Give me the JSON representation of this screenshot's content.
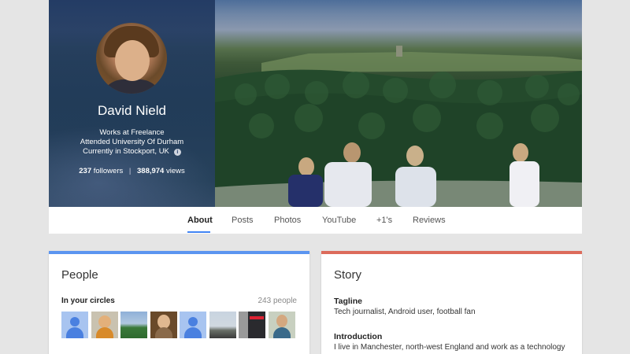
{
  "profile": {
    "name": "David Nield",
    "work": "Works at Freelance",
    "education": "Attended University Of Durham",
    "location": "Currently in Stockport, UK",
    "followers_count": "237",
    "followers_label": "followers",
    "views_count": "388,974",
    "views_label": "views"
  },
  "tabs": [
    {
      "label": "About",
      "active": true
    },
    {
      "label": "Posts"
    },
    {
      "label": "Photos"
    },
    {
      "label": "YouTube"
    },
    {
      "label": "+1's"
    },
    {
      "label": "Reviews"
    }
  ],
  "people": {
    "title": "People",
    "circles_label": "In your circles",
    "circles_count": "243 people"
  },
  "story": {
    "title": "Story",
    "tagline_heading": "Tagline",
    "tagline_text": "Tech journalist, Android user, football fan",
    "intro_heading": "Introduction",
    "intro_text": "I live in Manchester, north-west England and work as a technology"
  },
  "colors": {
    "people_accent": "#5b95f0",
    "story_accent": "#dc6b5b",
    "tab_active": "#4285f4"
  }
}
